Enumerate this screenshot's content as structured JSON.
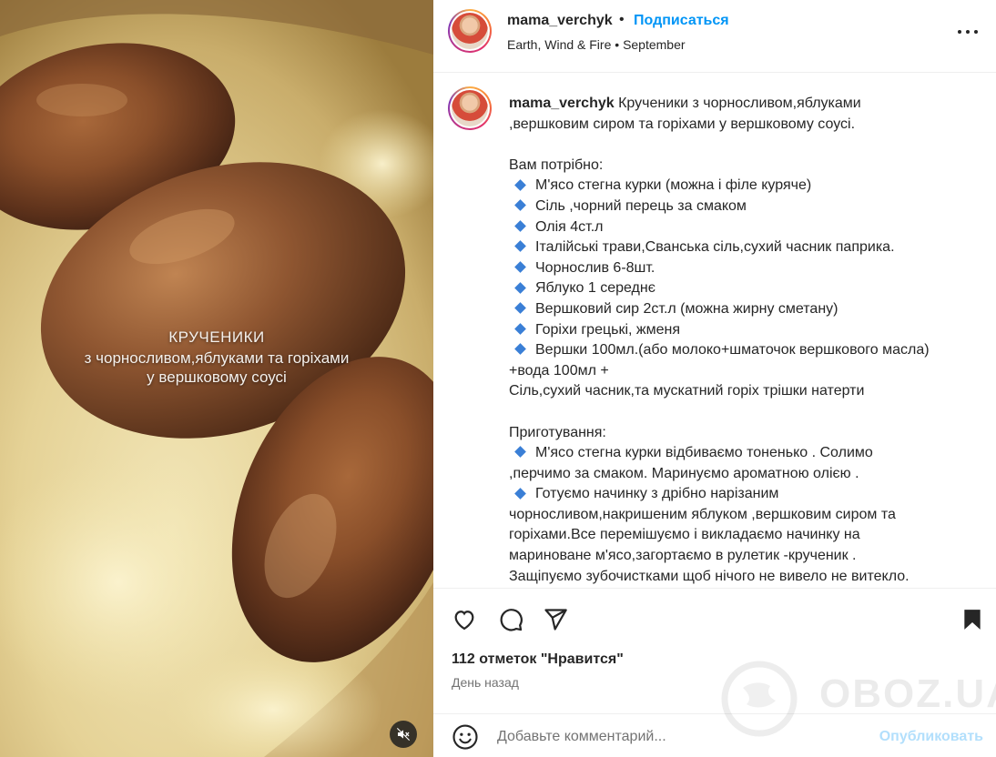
{
  "post": {
    "username": "mama_verchyk",
    "follow_label": "Подписаться",
    "separator": "•",
    "audio": "Earth, Wind & Fire",
    "location": "September"
  },
  "media": {
    "overlay_line1": "КРУЧЕНИКИ",
    "overlay_line2": "з чорносливом,яблуками та горіхами",
    "overlay_line3": "у вершковому соусі"
  },
  "caption": {
    "title_line1": "Крученики з чорносливом,яблуками",
    "title_line2": ",вершковим сиром та горіхами у вершковому соусі.",
    "need_heading": "Вам потрібно:",
    "ingredients": [
      "М'ясо стегна курки (можна і філе куряче)",
      "Сіль ,чорний перець за смаком",
      "Олія 4ст.л",
      "Італійські трави,Сванська сіль,сухий часник паприка.",
      "Чорнослив 6-8шт.",
      "Яблуко 1 середнє",
      "Вершковий сир 2ст.л (можна жирну сметану)",
      "Горіхи грецькі, жменя",
      "Вершки 100мл.(або молоко+шматочок вершкового масла)"
    ],
    "extra_line1": "+вода 100мл +",
    "extra_line2": "Сіль,сухий часник,та мускатний горіх трішки натерти",
    "prep_heading": "Приготування:",
    "step1_line1": "М'ясо стегна курки відбиваємо тоненько . Солимо",
    "step1_line2": ",перчимо за смаком. Маринуємо ароматною олією .",
    "step2_line1": "Готуємо начинку з дрібно нарізаним",
    "step2_line2": "чорносливом,накришеним яблуком ,вершковим сиром та",
    "step2_line3": "горіхами.Все перемішуємо і викладаємо начинку на",
    "step2_line4": "мариноване м'ясо,загортаємо в рулетик -крученик .",
    "step2_line5": "Защіпуємо зубочистками щоб нічого не вивело не витекло."
  },
  "stats": {
    "likes": "112 отметок \"Нравится\"",
    "time_ago": "День назад"
  },
  "comment": {
    "placeholder": "Добавьте комментарий...",
    "publish_label": "Опубликовать"
  },
  "watermark": {
    "text": "OBOZ.UA"
  },
  "colors": {
    "accent": "#0095f6",
    "publish_disabled": "#b2dffc",
    "bullet": "#3a7fd6",
    "text": "#262626",
    "muted": "#737373"
  }
}
